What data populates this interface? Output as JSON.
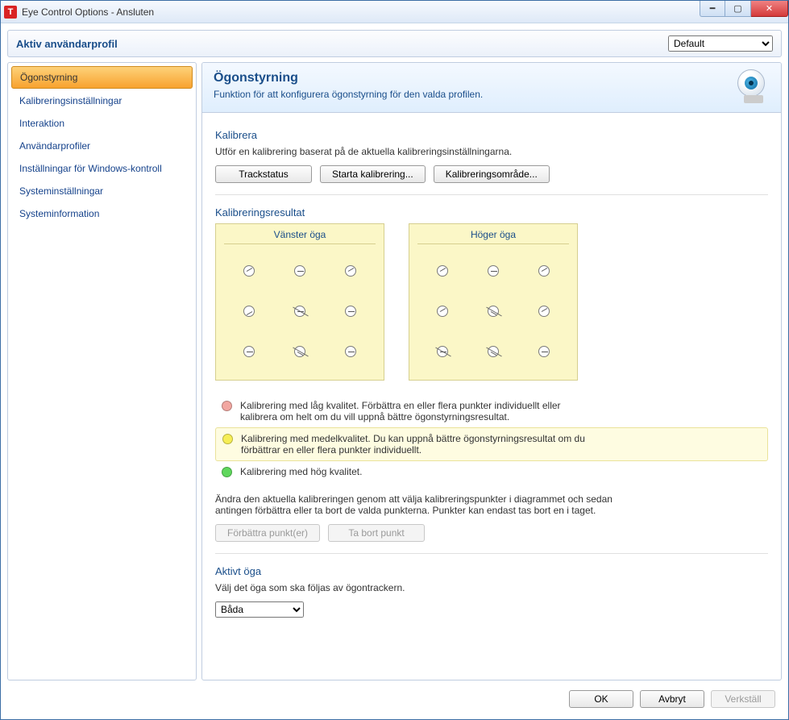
{
  "window": {
    "title": "Eye Control Options - Ansluten"
  },
  "profile_bar": {
    "label": "Aktiv användarprofil",
    "selected": "Default"
  },
  "sidebar": {
    "items": [
      {
        "label": "Ögonstyrning",
        "selected": true
      },
      {
        "label": "Kalibreringsinställningar",
        "selected": false
      },
      {
        "label": "Interaktion",
        "selected": false
      },
      {
        "label": "Användarprofiler",
        "selected": false
      },
      {
        "label": "Inställningar för Windows-kontroll",
        "selected": false
      },
      {
        "label": "Systeminställningar",
        "selected": false
      },
      {
        "label": "Systeminformation",
        "selected": false
      }
    ]
  },
  "header": {
    "title": "Ögonstyrning",
    "subtitle": "Funktion för att konfigurera ögonstyrning för den valda profilen."
  },
  "calibrate": {
    "title": "Kalibrera",
    "description": "Utför en kalibrering baserat på de aktuella kalibreringsinställningarna.",
    "buttons": {
      "trackstatus": "Trackstatus",
      "start": "Starta kalibrering...",
      "area": "Kalibreringsområde..."
    }
  },
  "result": {
    "title": "Kalibreringsresultat",
    "left_eye": "Vänster öga",
    "right_eye": "Höger öga",
    "legend": {
      "low": "Kalibrering med låg kvalitet. Förbättra en eller flera punkter individuellt eller kalibrera om helt om du vill uppnå bättre ögonstyrningsresultat.",
      "medium": "Kalibrering med medelkvalitet. Du kan uppnå bättre ögonstyrningsresultat om du förbättrar en eller flera punkter individuellt.",
      "high": "Kalibrering med hög kvalitet."
    },
    "legend_colors": {
      "low": "#f2a7a1",
      "medium": "#f6ee55",
      "high": "#5fd75c"
    },
    "instructions": "Ändra den aktuella kalibreringen genom att välja kalibreringspunkter i diagrammet och sedan antingen förbättra eller ta bort de valda punkterna. Punkter kan endast tas bort en i taget.",
    "buttons": {
      "improve": "Förbättra punkt(er)",
      "remove": "Ta bort punkt"
    }
  },
  "active_eye": {
    "title": "Aktivt öga",
    "description": "Välj det öga som ska följas av ögontrackern.",
    "selected": "Båda"
  },
  "footer": {
    "ok": "OK",
    "cancel": "Avbryt",
    "apply": "Verkställ"
  }
}
